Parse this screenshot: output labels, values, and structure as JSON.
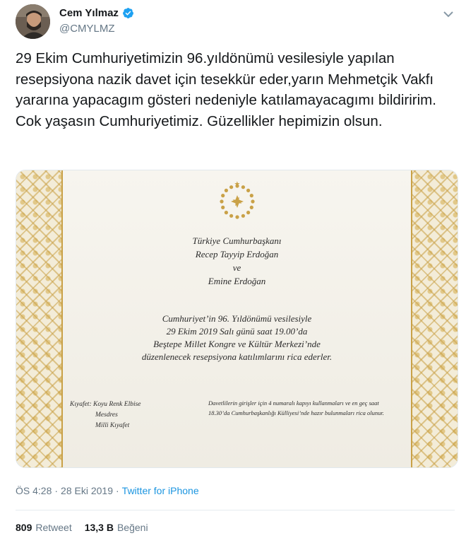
{
  "author": {
    "name": "Cem Yılmaz",
    "handle": "@CMYLMZ",
    "verified_color": "#1da1f2"
  },
  "tweet": {
    "text": "29 Ekim Cumhuriyetimizin 96.yıldönümü vesilesiyle yapılan resepsiyona nazik davet için tesekkür eder,yarın Mehmetçik Vakfı yararına yapacagım gösteri nedeniyle katılamayacagımı bildiririm. Cok yaşasın Cumhuriyetimiz. Güzellikler hepimizin olsun."
  },
  "invitation": {
    "line1": "Türkiye Cumhurbaşkanı",
    "line2": "Recep Tayyip Erdoğan",
    "line3": "ve",
    "line4": "Emine Erdoğan",
    "body1": "Cumhuriyet’in 96. Yıldönümü vesilesiyle",
    "body2": "29 Ekim 2019 Salı günü saat 19.00’da",
    "body3": "Beştepe Millet Kongre ve Kültür Merkezi’nde",
    "body4": "düzenlenecek resepsiyona katılımlarını rica ederler.",
    "dress1": "Kıyafet: Koyu Renk Elbise",
    "dress2": "Mesdres",
    "dress3": "Milli Kıyafet",
    "note1": "Davetlilerin girişler için 4 numaralı kapıyı kullanmaları ve en geç saat",
    "note2": "18.30’da Cumhurbaşkanlığı Külliyesi’nde hazır bulunmaları rica olunur."
  },
  "meta": {
    "time": "ÖS 4:28",
    "separator": "·",
    "date": "28 Eki 2019",
    "source": "Twitter for iPhone"
  },
  "stats": {
    "retweets_count": "809",
    "retweets_label": "Retweet",
    "likes_count": "13,3 B",
    "likes_label": "Beğeni"
  },
  "colors": {
    "gold": "#c9a147",
    "link": "#1b95e0",
    "muted": "#657786"
  }
}
